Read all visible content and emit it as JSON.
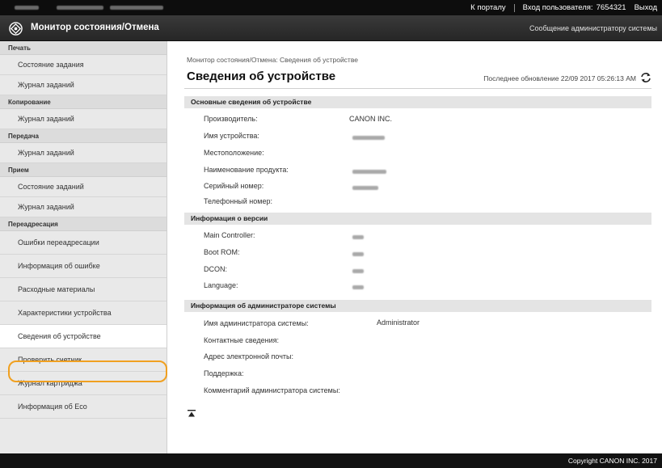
{
  "topbar": {
    "portal_link": "К порталу",
    "login_label": "Вход пользователя:",
    "login_user": "7654321",
    "logout": "Выход"
  },
  "header": {
    "title": "Монитор состояния/Отмена",
    "admin_message_link": "Сообщение администратору системы"
  },
  "sidebar": {
    "groups": [
      {
        "label": "Печать",
        "items": [
          "Состояние задания",
          "Журнал заданий"
        ]
      },
      {
        "label": "Копирование",
        "items": [
          "Журнал заданий"
        ]
      },
      {
        "label": "Передача",
        "items": [
          "Журнал заданий"
        ]
      },
      {
        "label": "Прием",
        "items": [
          "Состояние заданий",
          "Журнал заданий"
        ]
      },
      {
        "label": "Переадресация",
        "items": [
          "Ошибки переадресации"
        ]
      }
    ],
    "extra_items": [
      "Информация об ошибке",
      "Расходные материалы",
      "Характеристики устройства",
      "Сведения об устройстве",
      "Проверить счетчик",
      "Журнал картриджа",
      "Информация об Eco"
    ],
    "active_item": "Сведения об устройстве"
  },
  "main": {
    "breadcrumb": "Монитор состояния/Отмена: Сведения об устройстве",
    "page_title": "Сведения об устройстве",
    "last_update": "Последнее обновление 22/09 2017 05:26:13 AM",
    "sections": {
      "basic": {
        "title": "Основные сведения об устройстве",
        "rows": [
          {
            "label": "Производитель:",
            "value": "CANON INC."
          },
          {
            "label": "Имя устройства:",
            "value": ""
          },
          {
            "label": "Местоположение:",
            "value": ""
          },
          {
            "label": "Наименование продукта:",
            "value": ""
          },
          {
            "label": "Серийный номер:",
            "value": ""
          },
          {
            "label": "Телефонный номер:",
            "value": ""
          }
        ]
      },
      "version": {
        "title": "Информация о версии",
        "rows": [
          {
            "label": "Main Controller:",
            "value": ""
          },
          {
            "label": "Boot ROM:",
            "value": ""
          },
          {
            "label": "DCON:",
            "value": ""
          },
          {
            "label": "Language:",
            "value": ""
          }
        ]
      },
      "admin": {
        "title": "Информация об администраторе системы",
        "rows": [
          {
            "label": "Имя администратора системы:",
            "value": "Administrator"
          },
          {
            "label": "Контактные сведения:",
            "value": ""
          },
          {
            "label": "Адрес электронной почты:",
            "value": ""
          },
          {
            "label": "Поддержка:",
            "value": ""
          },
          {
            "label": "Комментарий администратора системы:",
            "value": ""
          }
        ]
      }
    }
  },
  "footer": {
    "copyright": "Copyright CANON INC. 2017"
  },
  "icons": {
    "logo": "canon-logo-icon",
    "refresh": "refresh-icon",
    "to_top": "back-to-top-icon"
  },
  "colors": {
    "highlight": "#f0a020",
    "topbar": "#0d0d0d"
  }
}
